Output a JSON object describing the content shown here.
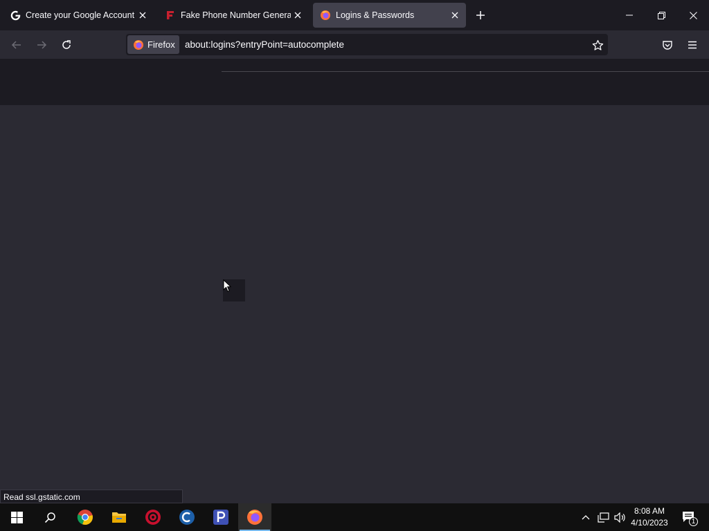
{
  "tabs": [
    {
      "title": "Create your Google Account",
      "icon": "google-icon"
    },
    {
      "title": "Fake Phone Number Generator",
      "icon": "fakephone-icon"
    },
    {
      "title": "Logins & Passwords",
      "icon": "firefox-icon",
      "active": true
    }
  ],
  "urlbar": {
    "identity_label": "Firefox",
    "url": "about:logins?entryPoint=autocomplete"
  },
  "status": {
    "text": "Read ssl.gstatic.com"
  },
  "clock": {
    "time": "8:08 AM",
    "date": "4/10/2023"
  },
  "notifications": {
    "count": "1"
  },
  "colors": {
    "accent": "#76b9ed",
    "chrome_dark": "#1c1b22",
    "chrome": "#2b2a33",
    "active_tab": "#42414d"
  }
}
